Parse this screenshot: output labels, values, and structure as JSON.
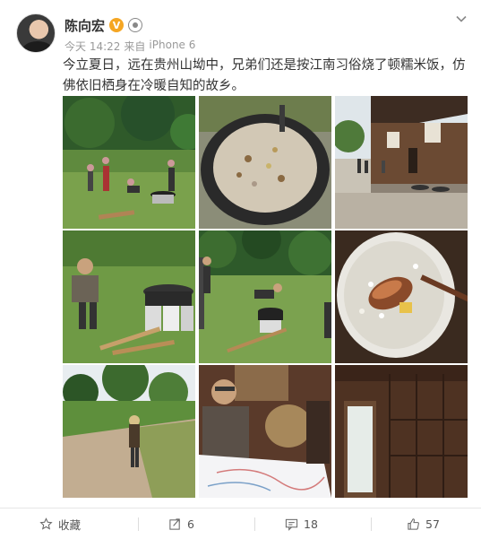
{
  "author": {
    "name": "陈向宏",
    "verified_mark": "V",
    "avatar_icon": "user-avatar-icon"
  },
  "meta": {
    "time": "今天 14:22",
    "source_prefix": "来自",
    "source": "iPhone 6"
  },
  "post": {
    "text": "今立夏日，远在贵州山坳中，兄弟们还是按江南习俗烧了顿糯米饭，仿佛依旧栖身在冷暖自知的故乡。"
  },
  "images": [
    {
      "name": "photo-cooking-outdoors"
    },
    {
      "name": "photo-rice-in-wok"
    },
    {
      "name": "photo-village-houses"
    },
    {
      "name": "photo-man-by-pot"
    },
    {
      "name": "photo-men-cooking-field"
    },
    {
      "name": "photo-rice-bowl-closeup"
    },
    {
      "name": "photo-hiker-on-path"
    },
    {
      "name": "photo-man-with-map"
    },
    {
      "name": "photo-wooden-house-interior"
    }
  ],
  "actions": {
    "favorite_label": "收藏",
    "repost_count": "6",
    "comment_count": "18",
    "like_count": "57"
  },
  "colors": {
    "verified": "#f5a623",
    "text": "#333333",
    "meta": "#999999"
  }
}
